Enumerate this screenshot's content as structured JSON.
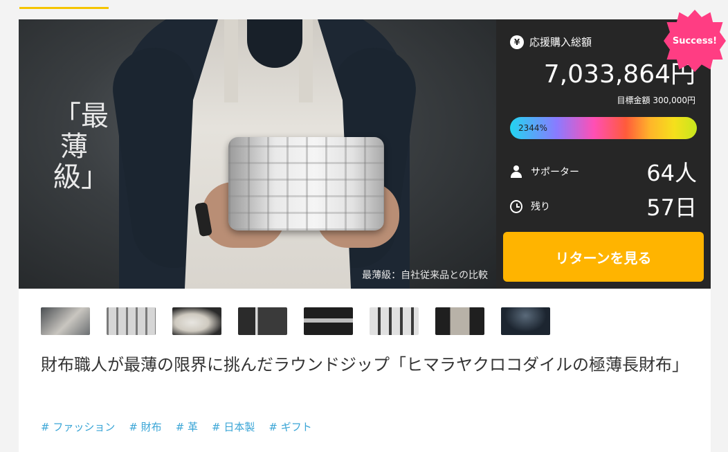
{
  "hero": {
    "vertical_text": "「最薄級」",
    "caption": "最薄級：自社従来品との比較"
  },
  "panel": {
    "amount_label": "応援購入総額",
    "amount": "7,033,864円",
    "goal": "目標金額 300,000円",
    "progress_text": "2344%",
    "progress_percent": 2344,
    "supporters_label": "サポーター",
    "supporters_value": "64人",
    "remaining_label": "残り",
    "remaining_value": "57日",
    "return_button": "リターンを見る",
    "badge": "Success!",
    "yen_glyph": "¥"
  },
  "thumbnails": [
    {
      "name": "thumb-1"
    },
    {
      "name": "thumb-2"
    },
    {
      "name": "thumb-3"
    },
    {
      "name": "thumb-4"
    },
    {
      "name": "thumb-5"
    },
    {
      "name": "thumb-6"
    },
    {
      "name": "thumb-7"
    },
    {
      "name": "thumb-8"
    }
  ],
  "project": {
    "title": "財布職人が最薄の限界に挑んだラウンドジップ「ヒマラヤクロコダイルの極薄長財布」"
  },
  "tags": [
    "# ファッション",
    "# 財布",
    "# 革",
    "# 日本製",
    "# ギフト"
  ],
  "colors": {
    "accent": "#ffb400",
    "badge": "#ff3d83",
    "tag": "#3aa5d6",
    "panel_bg": "#262626"
  }
}
